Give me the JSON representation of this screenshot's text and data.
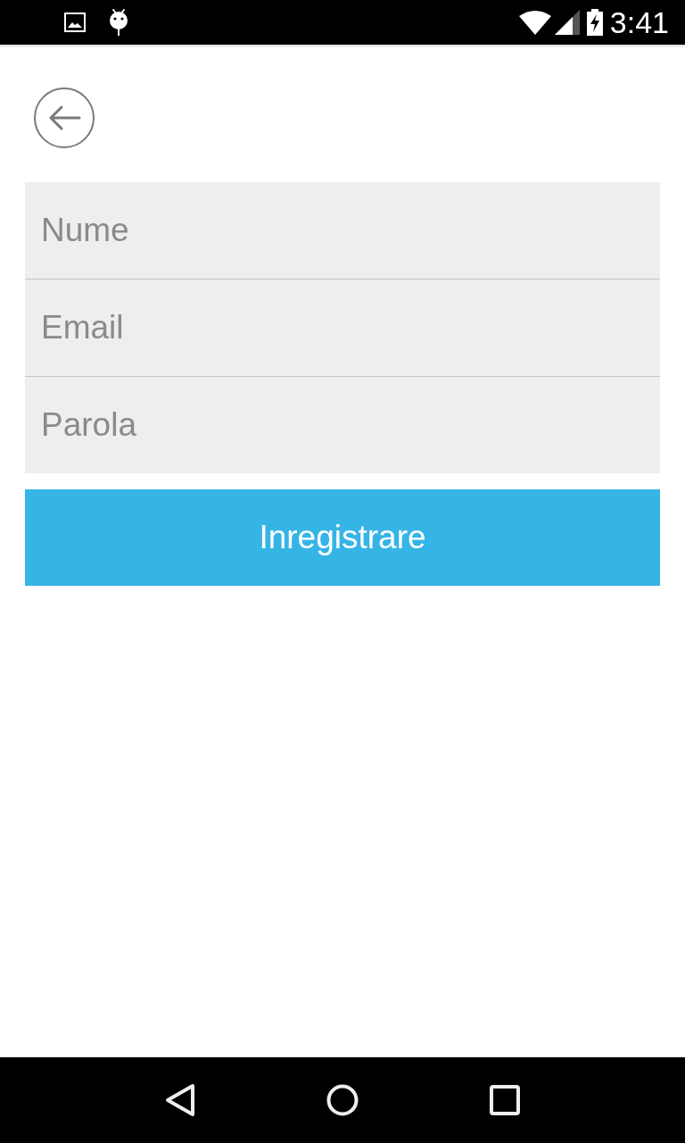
{
  "status_bar": {
    "time": "3:41"
  },
  "form": {
    "fields": [
      {
        "placeholder": "Nume"
      },
      {
        "placeholder": "Email"
      },
      {
        "placeholder": "Parola"
      }
    ],
    "submit_button": {
      "label": "Inregistrare"
    }
  }
}
